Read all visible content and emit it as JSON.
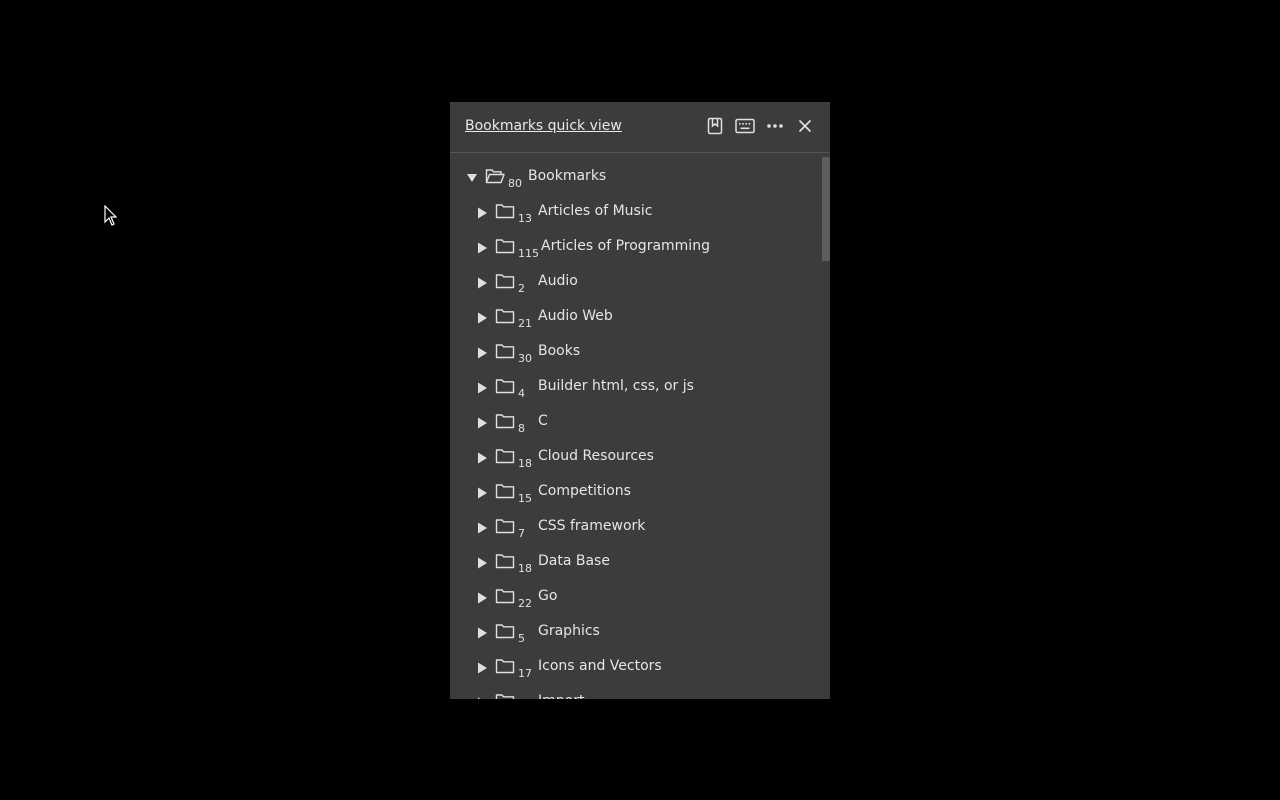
{
  "panel": {
    "title": "Bookmarks quick view",
    "buttons": [
      {
        "name": "bookmark-page-button",
        "icon": "bookmark-icon"
      },
      {
        "name": "keyboard-shortcuts-button",
        "icon": "keyboard-icon"
      },
      {
        "name": "more-options-button",
        "icon": "ellipsis-icon"
      },
      {
        "name": "close-button",
        "icon": "close-icon"
      }
    ]
  },
  "tree": {
    "root": {
      "label": "Bookmarks",
      "count": "80",
      "expanded": true
    },
    "items": [
      {
        "label": "Articles of Music",
        "count": "13"
      },
      {
        "label": "Articles of Programming",
        "count": "115"
      },
      {
        "label": "Audio",
        "count": "2"
      },
      {
        "label": "Audio Web",
        "count": "21"
      },
      {
        "label": "Books",
        "count": "30"
      },
      {
        "label": "Builder html, css, or js",
        "count": "4"
      },
      {
        "label": "C",
        "count": "8"
      },
      {
        "label": "Cloud Resources",
        "count": "18"
      },
      {
        "label": "Competitions",
        "count": "15"
      },
      {
        "label": "CSS framework",
        "count": "7"
      },
      {
        "label": "Data Base",
        "count": "18"
      },
      {
        "label": "Go",
        "count": "22"
      },
      {
        "label": "Graphics",
        "count": "5"
      },
      {
        "label": "Icons and Vectors",
        "count": "17"
      },
      {
        "label": "Import",
        "count": ""
      }
    ]
  },
  "colors": {
    "background": "#000000",
    "panel": "#3c3c3c",
    "text": "#e6e6e6",
    "scroll_thumb": "#5e5e5e"
  }
}
